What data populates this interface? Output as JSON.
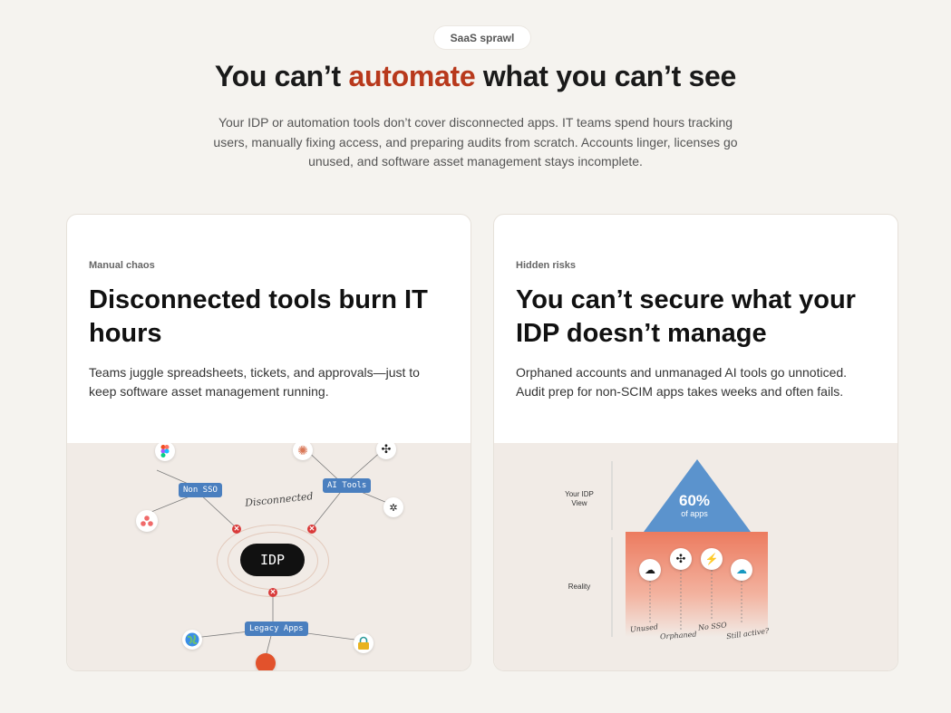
{
  "hero": {
    "pill": "SaaS sprawl",
    "headline_pre": "You can’t ",
    "headline_accent": "automate",
    "headline_post": " what you can’t see",
    "subtitle": "Your IDP or automation tools don’t cover disconnected apps. IT teams spend hours tracking users, manually fixing access, and preparing audits from scratch. Accounts linger, licenses go unused, and software asset management stays incomplete."
  },
  "cards": [
    {
      "eyebrow": "Manual chaos",
      "title": "Disconnected tools burn IT hours",
      "body": "Teams juggle spreadsheets, tickets, and approvals—just to keep software asset management running.",
      "diagram": {
        "center": "IDP",
        "note": "Disconnected",
        "tags": {
          "non_sso": "Non SSO",
          "ai_tools": "AI Tools",
          "legacy": "Legacy Apps"
        },
        "icons": [
          "figma-icon",
          "asana-icon",
          "claude-icon",
          "openai-icon",
          "robot-icon",
          "globe-icon",
          "lock-icon",
          "tool-icon"
        ]
      }
    },
    {
      "eyebrow": "Hidden risks",
      "title": "You can’t secure what your IDP doesn’t manage",
      "body": "Orphaned accounts and unmanaged AI tools go unnoticed. Audit prep for non-SCIM apps takes weeks and often fails.",
      "diagram": {
        "label_view": "Your IDP View",
        "label_reality": "Reality",
        "percent": "60%",
        "percent_sub": "of apps",
        "markers": [
          "Unused",
          "Orphaned",
          "No SSO",
          "Still active?"
        ],
        "icons": [
          "cloud-icon",
          "openai-icon",
          "bolt-icon",
          "salesforce-icon"
        ]
      }
    }
  ],
  "colors": {
    "accent": "#b8391c",
    "tag_blue": "#4a7fbf",
    "triangle_blue": "#5b93cd",
    "reality_coral": "#ec7b5f"
  }
}
